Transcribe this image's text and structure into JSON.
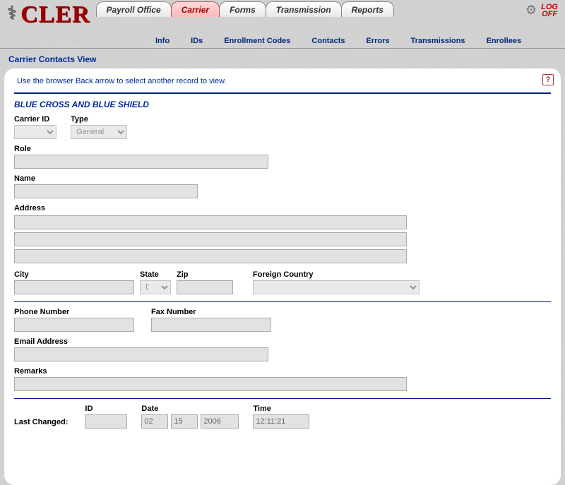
{
  "app": {
    "logo": "CLER"
  },
  "main_tabs": [
    {
      "label": "Payroll Office",
      "active": false
    },
    {
      "label": "Carrier",
      "active": true
    },
    {
      "label": "Forms",
      "active": false
    },
    {
      "label": "Transmission",
      "active": false
    },
    {
      "label": "Reports",
      "active": false
    }
  ],
  "logoff": {
    "line1": "LOG",
    "line2": "OFF"
  },
  "sub_tabs": [
    {
      "label": "Info"
    },
    {
      "label": "IDs"
    },
    {
      "label": "Enrollment Codes"
    },
    {
      "label": "Contacts"
    },
    {
      "label": "Errors"
    },
    {
      "label": "Transmissions"
    },
    {
      "label": "Enrollees"
    }
  ],
  "page_title": "Carrier Contacts View",
  "instruction": "Use the browser Back arrow to select another record to view.",
  "help_tooltip": "?",
  "carrier_name": "BLUE CROSS AND BLUE SHIELD",
  "labels": {
    "carrier_id": "Carrier ID",
    "type": "Type",
    "role": "Role",
    "name": "Name",
    "address": "Address",
    "city": "City",
    "state": "State",
    "zip": "Zip",
    "foreign_country": "Foreign Country",
    "phone": "Phone Number",
    "fax": "Fax Number",
    "email": "Email Address",
    "remarks": "Remarks",
    "last_changed": "Last Changed:",
    "id": "ID",
    "date": "Date",
    "time": "Time"
  },
  "fields": {
    "carrier_id": "",
    "type": "General",
    "role": "",
    "name": "",
    "address1": "",
    "address2": "",
    "address3": "",
    "city": "",
    "state": "DC",
    "zip": "",
    "foreign_country": "",
    "phone": "",
    "fax": "",
    "email": "",
    "remarks": "",
    "last_changed_id": "",
    "date_mm": "02",
    "date_dd": "15",
    "date_yyyy": "2006",
    "time": "12:11:21"
  }
}
